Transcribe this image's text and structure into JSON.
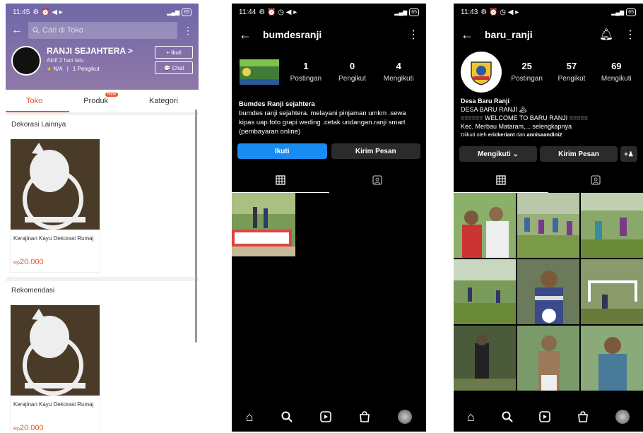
{
  "phone1": {
    "status": {
      "time": "11:45",
      "battery": "65"
    },
    "search": {
      "placeholder": "Cari di Toko"
    },
    "shop": {
      "name": "RANJI SEJAHTERA >",
      "active": "Aktif 2 hari lalu",
      "rating": "N/A",
      "followers": "1 Pengikut",
      "follow_label": "+ Ikuti",
      "chat_label": "Chat"
    },
    "tabs": [
      "Toko",
      "Produk",
      "Kategori"
    ],
    "new_badge": "New",
    "sections": [
      {
        "title": "Dekorasi Lainnya",
        "product": {
          "name": "Kerajinan Kayu Dekorasi Rumaj",
          "currency": "Rp",
          "price": "20.000"
        }
      },
      {
        "title": "Rekomendasi",
        "product": {
          "name": "Kerajinan Kayu Dekorasi Rumaj",
          "currency": "Rp",
          "price": "20.000"
        }
      }
    ]
  },
  "phone2": {
    "status": {
      "time": "11:44",
      "battery": "65"
    },
    "username": "bumdesranji",
    "stats": [
      {
        "value": "1",
        "label": "Postingan"
      },
      {
        "value": "0",
        "label": "Pengikut"
      },
      {
        "value": "4",
        "label": "Mengikuti"
      }
    ],
    "bio_name": "Bumdes Ranji sejahtera",
    "bio_text": "bumdes ranji sejahtera. melayani pinjaman umkm .sewa kipas uap.foto grapi weding .cetak undangan.ranji smart (pembayaran online)",
    "follow_label": "Ikuti",
    "message_label": "Kirim Pesan"
  },
  "phone3": {
    "status": {
      "time": "11:43",
      "battery": "65"
    },
    "username": "baru_ranji",
    "stats": [
      {
        "value": "25",
        "label": "Postingan"
      },
      {
        "value": "57",
        "label": "Pengikut"
      },
      {
        "value": "69",
        "label": "Mengikuti"
      }
    ],
    "bio_name": "Desa Baru Ranji",
    "bio_lines": [
      "DESA BARU RANJI 🏔",
      "====== WELCOME TO BARU RANJI =====",
      "Kec. Merbau Mataram,... selengkapnya"
    ],
    "followed_by_prefix": "Diikuti oleh",
    "followed_by_1": "erickeriant",
    "followed_by_and": "dan",
    "followed_by_2": "annisaandini2",
    "following_label": "Mengikuti ⌄",
    "message_label": "Kirim Pesan"
  },
  "colors": {
    "shopee_accent": "#e4572e",
    "ig_blue": "#1a8cf0"
  }
}
